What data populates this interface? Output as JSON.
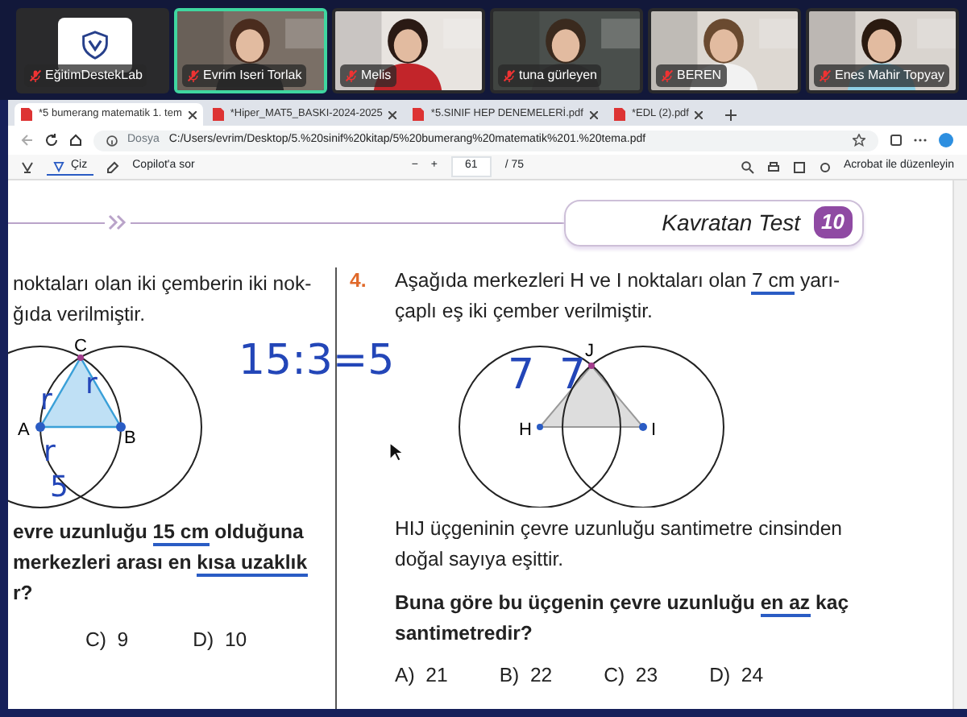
{
  "participants": [
    {
      "name": "EğitimDestekLab",
      "kind": "logo",
      "selected": false,
      "muted": true
    },
    {
      "name": "Evrim Iseri Torlak",
      "kind": "video",
      "selected": true,
      "muted": true
    },
    {
      "name": "Melis",
      "kind": "video",
      "selected": false,
      "muted": true
    },
    {
      "name": "tuna gürleyen",
      "kind": "video",
      "selected": false,
      "muted": true
    },
    {
      "name": "BEREN",
      "kind": "video",
      "selected": false,
      "muted": true
    },
    {
      "name": "Enes Mahir Topyay",
      "kind": "video",
      "selected": false,
      "muted": true
    }
  ],
  "browser": {
    "tabs": [
      {
        "label": "*5 bumerang matematik 1. tem",
        "selected": true
      },
      {
        "label": "*Hiper_MAT5_BASKI-2024-2025",
        "selected": false
      },
      {
        "label": "*5.SINIF HEP DENEMELERİ.pdf",
        "selected": false
      },
      {
        "label": "*EDL (2).pdf",
        "selected": false
      }
    ],
    "address": {
      "label": "Dosya",
      "url": "C:/Users/evrim/Desktop/5.%20sinif%20kitap/5%20bumerang%20matematik%201.%20tema.pdf"
    },
    "toolbar": {
      "draw": "Çiz",
      "copilot": "Copilot'a sor",
      "zoom_out": "−",
      "zoom_in": "+",
      "page": "61",
      "page_count": "/ 75",
      "acrobat": "Acrobat ile düzenleyin"
    }
  },
  "document": {
    "header": {
      "title": "Kavratan Test",
      "number": "10"
    },
    "left": {
      "intro": [
        "noktaları olan iki çemberin iki nok-",
        "ğıda verilmiştir."
      ],
      "figure_labels": [
        "C",
        "A",
        "B"
      ],
      "question": [
        [
          {
            "text": "evre uzunluğu ",
            "marked": false
          },
          {
            "text": "15 cm",
            "marked": true
          },
          {
            "text": " olduğuna",
            "marked": false
          }
        ],
        [
          {
            "text": "merkezleri arası en ",
            "marked": false
          },
          {
            "text": "kısa uzaklık",
            "marked": true
          }
        ],
        [
          {
            "text": "r?",
            "marked": false
          }
        ]
      ],
      "options": [
        "C)  9",
        "D)  10"
      ]
    },
    "right": {
      "number": "4.",
      "intro": [
        [
          {
            "text": "Aşağıda merkezleri H ve I noktaları olan ",
            "marked": false
          },
          {
            "text": "7 cm",
            "marked": true
          },
          {
            "text": " yarı-",
            "marked": false
          }
        ],
        [
          {
            "text": "çaplı eş iki çember verilmiştir.",
            "marked": false
          }
        ]
      ],
      "figure_labels": [
        "J",
        "H",
        "I"
      ],
      "body": [
        "HIJ üçgeninin çevre uzunluğu santimetre cinsinden",
        "doğal sayıya eşittir."
      ],
      "question": [
        [
          {
            "text": "Buna göre bu üçgenin çevre uzunluğu ",
            "marked": false
          },
          {
            "text": "en az",
            "marked": true
          },
          {
            "text": " kaç",
            "marked": false
          }
        ],
        [
          {
            "text": "santimetredir?",
            "marked": false
          }
        ]
      ],
      "options": [
        "A)  21",
        "B)  22",
        "C)  23",
        "D)  24"
      ]
    },
    "handwriting": [
      "15:3=5",
      "r",
      "r",
      "r",
      "5",
      "7",
      "7"
    ]
  }
}
